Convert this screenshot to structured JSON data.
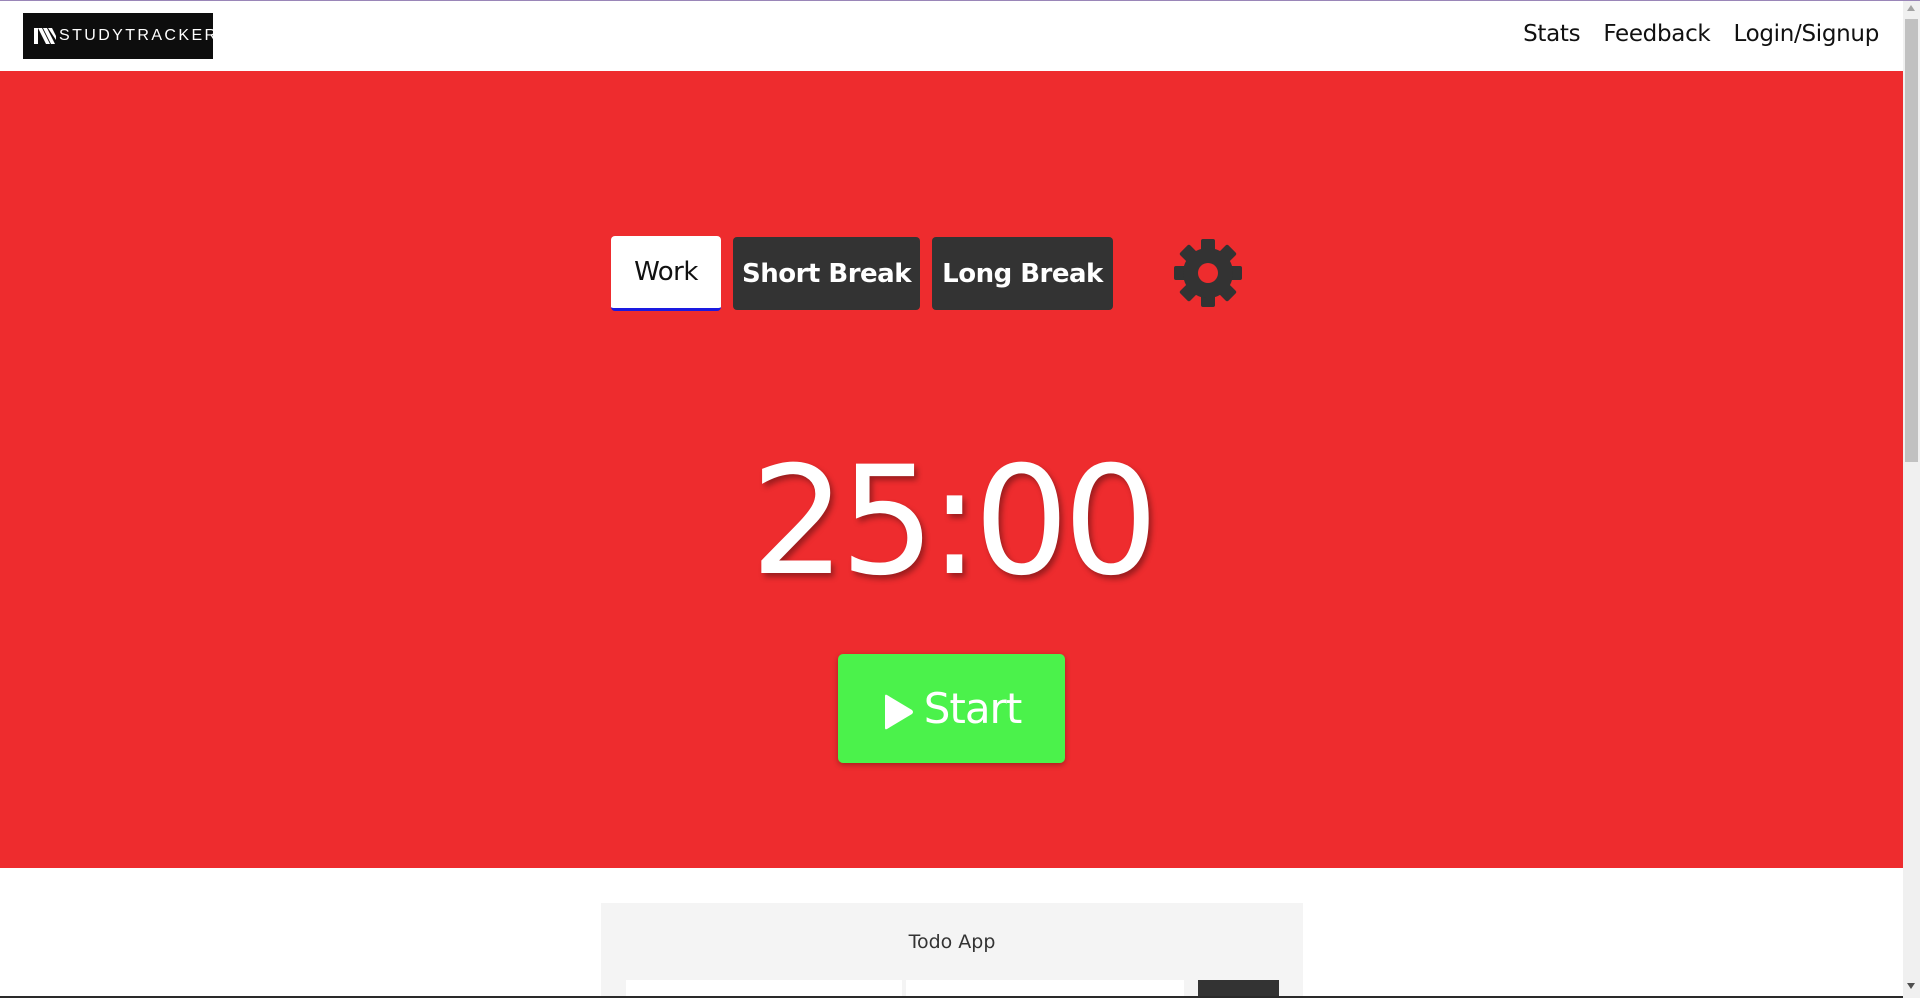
{
  "brand": {
    "logo_text": "STUDYTRACKER",
    "logo_icon": "studytracker-logo-icon"
  },
  "nav": {
    "links": [
      "Stats",
      "Feedback",
      "Login/Signup"
    ]
  },
  "timer": {
    "modes": [
      "Work",
      "Short Break",
      "Long Break"
    ],
    "active_mode": "Work",
    "settings_icon": "gear-icon",
    "time": "25:00",
    "start_label": "Start",
    "start_icon": "play-icon"
  },
  "todo": {
    "title": "Todo App"
  },
  "colors": {
    "hero_background": "#ee2c2e",
    "start_button": "#4bf24b",
    "inactive_tab": "#333333",
    "active_tab_underline": "#1a1ae0"
  }
}
